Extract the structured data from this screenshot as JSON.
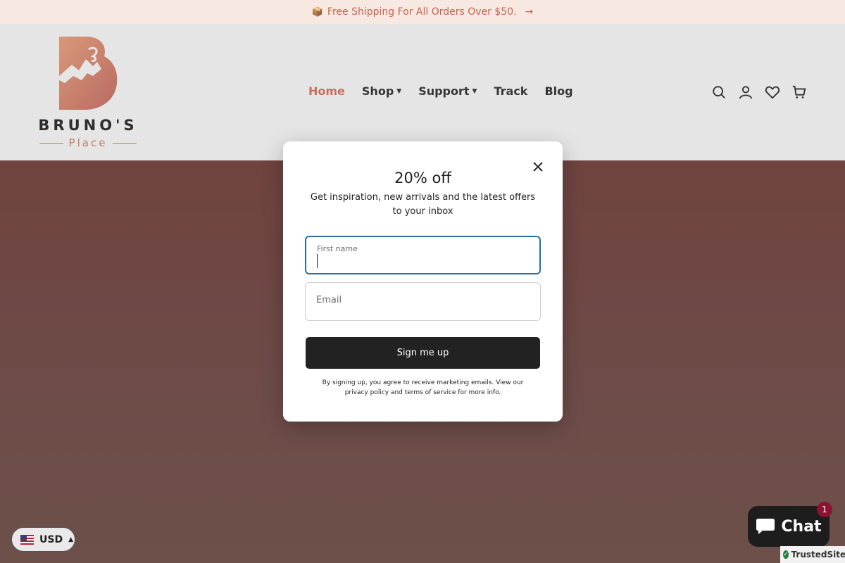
{
  "announcement": {
    "icon": "package-icon",
    "text": "Free Shipping For All Orders Over $50.",
    "arrow": "→"
  },
  "brand": {
    "name": "BRUNO'S",
    "sub": "Place",
    "accent": "#d08668"
  },
  "nav": {
    "items": [
      {
        "label": "Home",
        "active": true
      },
      {
        "label": "Shop",
        "dropdown": true
      },
      {
        "label": "Support",
        "dropdown": true
      },
      {
        "label": "Track"
      },
      {
        "label": "Blog"
      }
    ]
  },
  "header_icons": [
    "search-icon",
    "account-icon",
    "wishlist-icon",
    "cart-icon"
  ],
  "modal": {
    "title": "20% off",
    "description": "Get inspiration, new arrivals and the latest offers to your inbox",
    "first_name_label": "First name",
    "email_label": "Email",
    "submit_label": "Sign me up",
    "legal": "By signing up, you agree to receive marketing emails. View our privacy policy and terms of service for more info."
  },
  "currency": {
    "code": "USD",
    "flag": "us-flag-icon"
  },
  "chat": {
    "label": "Chat",
    "badge": "1"
  },
  "trusted": {
    "label": "TrustedSite"
  },
  "colors": {
    "accent": "#d86f5c",
    "announce_bg": "#f7e9e2",
    "focus": "#2a6ea8",
    "button": "#222222"
  }
}
